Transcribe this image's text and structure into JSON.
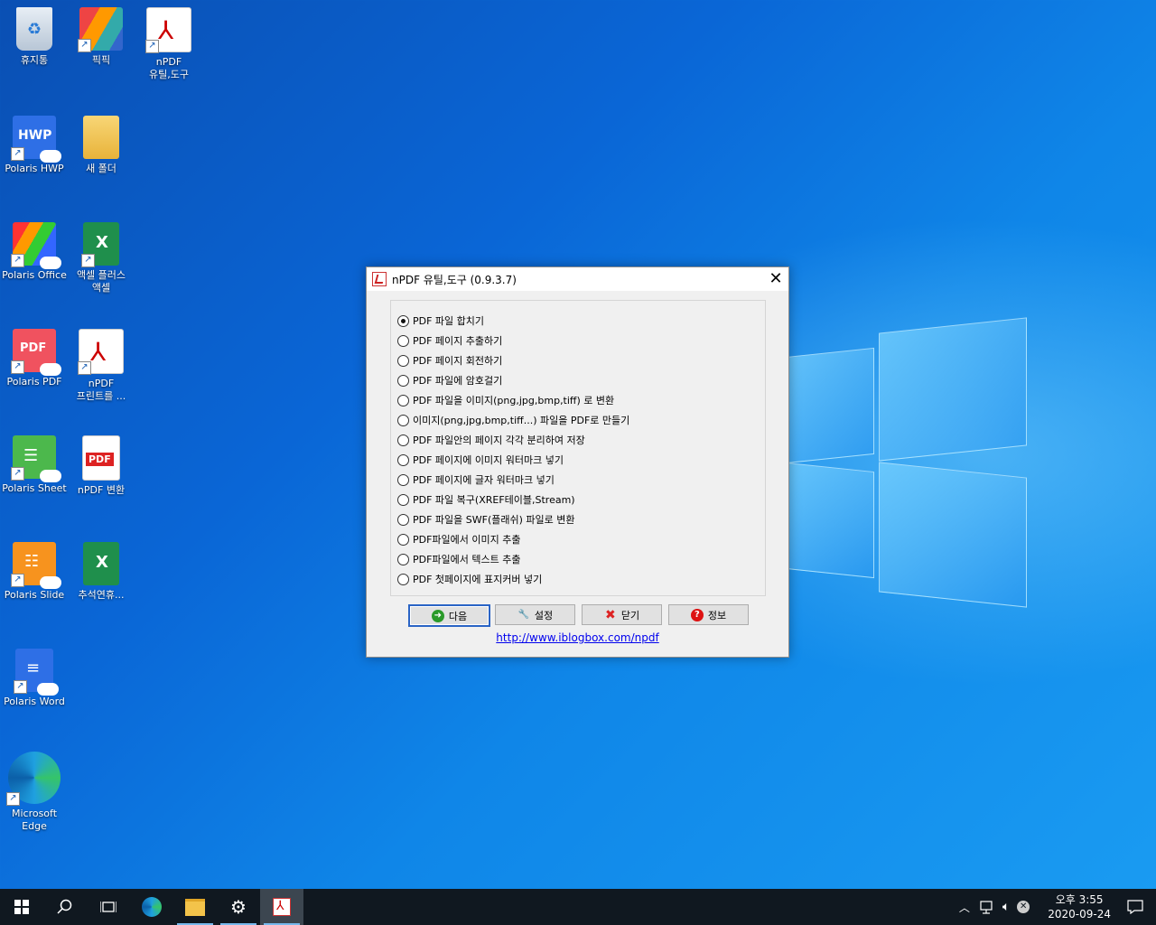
{
  "desktop": {
    "icons": [
      {
        "label": "휴지통"
      },
      {
        "label": "픽픽"
      },
      {
        "label": "nPDF\n유틸,도구"
      },
      {
        "label": "Polaris HWP"
      },
      {
        "label": "새 폴더"
      },
      {
        "label": "Polaris Office"
      },
      {
        "label": "액셀 플러스\n액셀"
      },
      {
        "label": "Polaris PDF"
      },
      {
        "label": "nPDF\n프린트를 ..."
      },
      {
        "label": "Polaris Sheet"
      },
      {
        "label": "nPDF 변환"
      },
      {
        "label": "Polaris Slide"
      },
      {
        "label": "추석연휴..."
      },
      {
        "label": "Polaris Word"
      },
      {
        "label": "Microsoft\nEdge"
      }
    ],
    "hwp_text": "HWP",
    "pdf_text": "PDF",
    "xls_text": "X"
  },
  "dialog": {
    "title": "nPDF 유틸,도구 (0.9.3.7)",
    "close_glyph": "✕",
    "options": [
      {
        "label": "PDF 파일 합치기",
        "checked": true
      },
      {
        "label": "PDF 페이지 추출하기",
        "checked": false
      },
      {
        "label": "PDF 페이지 회전하기",
        "checked": false
      },
      {
        "label": "PDF 파일에 암호걸기",
        "checked": false
      },
      {
        "label": "PDF 파일을 이미지(png,jpg,bmp,tiff) 로 변환",
        "checked": false
      },
      {
        "label": "이미지(png,jpg,bmp,tiff...) 파일을 PDF로 만들기",
        "checked": false
      },
      {
        "label": "PDF 파일안의 페이지 각각 분리하여 저장",
        "checked": false
      },
      {
        "label": "PDF 페이지에 이미지 워터마크 넣기",
        "checked": false
      },
      {
        "label": "PDF 페이지에 글자 워터마크 넣기",
        "checked": false
      },
      {
        "label": "PDF 파일 복구(XREF테이블,Stream)",
        "checked": false
      },
      {
        "label": "PDF 파일을 SWF(플래쉬) 파일로 변환",
        "checked": false
      },
      {
        "label": "PDF파일에서 이미지 추출",
        "checked": false
      },
      {
        "label": "PDF파일에서 텍스트 추출",
        "checked": false
      },
      {
        "label": "PDF 첫페이지에 표지커버 넣기",
        "checked": false
      }
    ],
    "buttons": {
      "next": "다음",
      "settings": "설정",
      "close": "닫기",
      "info": "정보"
    },
    "link": "http://www.iblogbox.com/npdf"
  },
  "taskbar": {
    "clock_ampm_time": "오후 3:55",
    "clock_date": "2020-09-24"
  }
}
